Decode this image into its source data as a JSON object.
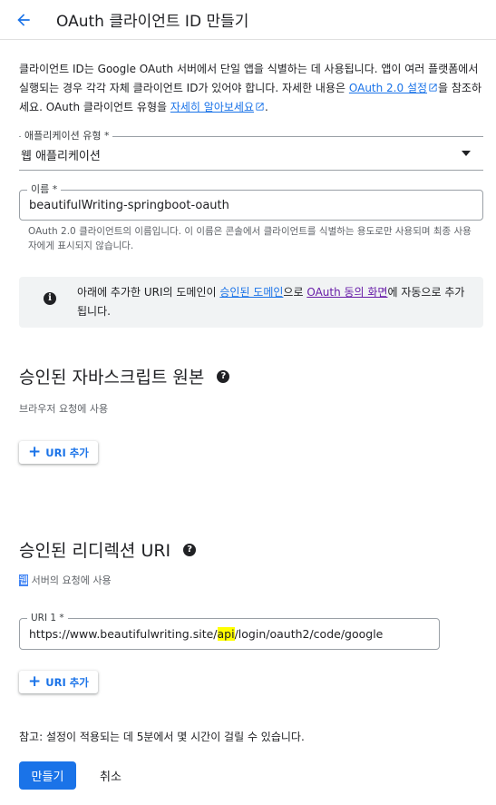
{
  "header": {
    "title": "OAuth 클라이언트 ID 만들기"
  },
  "intro": {
    "text1": "클라이언트 ID는 Google OAuth 서버에서 단일 앱을 식별하는 데 사용됩니다. 앱이 여러 플랫폼에서 실행되는 경우 각각 자체 클라이언트 ID가 있어야 합니다. 자세한 내용은 ",
    "link1": "OAuth 2.0 설정",
    "text2": "을 참조하세요. OAuth 클라이언트 유형을 ",
    "link2": "자세히 알아보세요",
    "text3": "."
  },
  "app_type": {
    "label": "애플리케이션 유형 *",
    "value": "웹 애플리케이션"
  },
  "name_field": {
    "label": "이름 *",
    "value": "beautifulWriting-springboot-oauth",
    "helper": "OAuth 2.0 클라이언트의 이름입니다. 이 이름은 콘솔에서 클라이언트를 식별하는 용도로만 사용되며 최종 사용자에게 표시되지 않습니다."
  },
  "info": {
    "text1": "아래에 추가한 URI의 도메인이 ",
    "link1": "승인된 도메인",
    "text2": "으로 ",
    "link2": "OAuth 동의 화면",
    "text3": "에 자동으로 추가됩니다."
  },
  "js_origins": {
    "title": "승인된 자바스크립트 원본",
    "subtitle": "브라우저 요청에 사용",
    "add_label": "URI 추가"
  },
  "redirect_uris": {
    "title": "승인된 리디렉션 URI",
    "subtitle_highlight": "웹",
    "subtitle_rest": " 서버의 요청에 사용",
    "uri_label": "URI 1 *",
    "uri_prefix": "https://www.beautifulwriting.site/",
    "uri_highlight": "api",
    "uri_suffix": "/login/oauth2/code/google",
    "add_label": "URI 추가"
  },
  "note": "참고: 설정이 적용되는 데 5분에서 몇 시간이 걸릴 수 있습니다.",
  "buttons": {
    "create": "만들기",
    "cancel": "취소"
  },
  "colors": {
    "accent": "#1a73e8",
    "visited_link": "#681da8",
    "info_bg": "#f1f3f4",
    "highlight": "#ffff00"
  },
  "icons": [
    "arrow-back-icon",
    "external-link-icon",
    "dropdown-arrow-icon",
    "info-icon",
    "help-icon",
    "plus-icon"
  ]
}
